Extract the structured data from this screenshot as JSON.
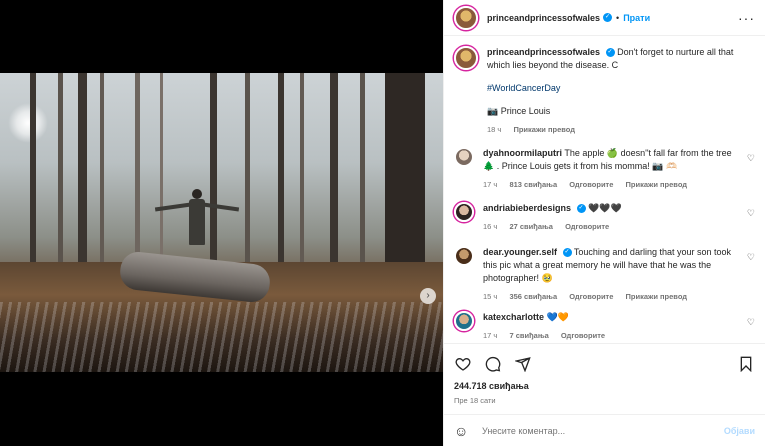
{
  "post": {
    "author": "princeandprincessofwales",
    "follow_label": "Прати",
    "caption_text": "Don't forget to nurture all that which lies beyond the disease. C",
    "hashtag": "#WorldCancerDay",
    "credit": "📷 Prince Louis",
    "caption_time": "18 ч",
    "translate_label": "Прикажи превод",
    "likes": "244.718 свиђања",
    "posted_ago": "Пре 18 сати"
  },
  "comments": [
    {
      "user": "dyahnoormilaputri",
      "text": "The apple 🍏 doesn''t fall far from the tree 🌲 . Prince Louis gets it from his momma! 📷 🫶🏻",
      "time": "17 ч",
      "likes": "813 свиђања",
      "reply": "Одговорите",
      "translate": "Прикажи превод"
    },
    {
      "user": "andriabieberdesigns",
      "text": "🖤🖤🖤",
      "time": "16 ч",
      "likes": "27 свиђања",
      "reply": "Одговорите"
    },
    {
      "user": "dear.younger.self",
      "text": "Touching and darling that your son took this pic what a great memory he will have that he was the photographer! 🥹",
      "time": "15 ч",
      "likes": "356 свиђања",
      "reply": "Одговорите",
      "translate": "Прикажи превод"
    },
    {
      "user": "katexcharlotte",
      "text": "💙🧡",
      "time": "17 ч",
      "likes": "7 свиђања",
      "reply": "Одговорите"
    }
  ],
  "composer": {
    "placeholder": "Унесите коментар...",
    "post_label": "Објави"
  },
  "colors": {
    "accent": "#0095f6",
    "text": "#262626",
    "muted": "#737373"
  },
  "icons": [
    "more-icon",
    "verified-badge-icon",
    "heart-icon",
    "comment-icon",
    "share-icon",
    "bookmark-icon",
    "emoji-icon",
    "next-arrow-icon"
  ]
}
